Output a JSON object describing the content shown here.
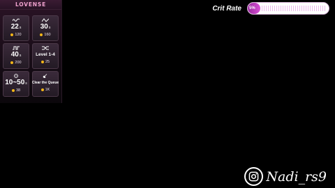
{
  "panel": {
    "brand": "LOVENSE",
    "tiles": [
      {
        "icon": "wave-icon",
        "value": "22",
        "unit": "s",
        "price": "120"
      },
      {
        "icon": "zigzag-icon",
        "value": "30",
        "unit": "s",
        "price": "160"
      },
      {
        "icon": "pulse-icon",
        "value": "40",
        "unit": "s",
        "price": "200"
      },
      {
        "icon": "shuffle-icon",
        "value": "Level 1-4",
        "unit": "",
        "price": "25"
      },
      {
        "icon": "dice-icon",
        "value": "10~50",
        "unit": "s",
        "price": "38"
      },
      {
        "icon": "broom-icon",
        "value": "Clear the Queue",
        "unit": "",
        "price": "1K"
      }
    ]
  },
  "crit": {
    "label": "Crit Rate",
    "percent_text": "5%",
    "fraction": 0.05,
    "fill_color": "#c43fc4"
  },
  "watermark": {
    "icon": "instagram-icon",
    "handle": "Nadi_rs9"
  }
}
